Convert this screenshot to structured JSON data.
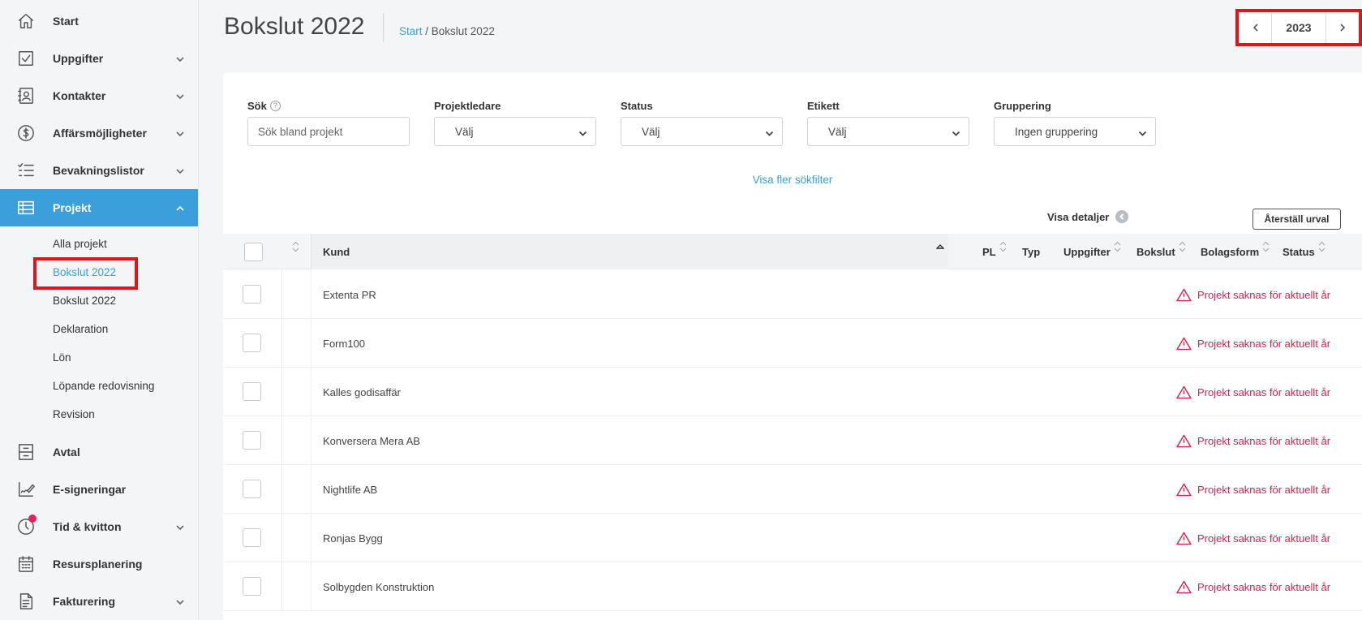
{
  "sidebar": {
    "items": [
      {
        "label": "Start",
        "icon": "home-icon"
      },
      {
        "label": "Uppgifter",
        "icon": "checkbox-icon"
      },
      {
        "label": "Kontakter",
        "icon": "contact-card-icon"
      },
      {
        "label": "Affärsmöjligheter",
        "icon": "dollar-icon"
      },
      {
        "label": "Bevakningslistor",
        "icon": "checklist-icon"
      },
      {
        "label": "Projekt",
        "icon": "table-icon"
      },
      {
        "label": "Avtal",
        "icon": "cabinet-icon"
      },
      {
        "label": "E-signeringar",
        "icon": "signature-icon"
      },
      {
        "label": "Tid & kvitton",
        "icon": "clock-icon"
      },
      {
        "label": "Resursplanering",
        "icon": "calendar-icon"
      },
      {
        "label": "Fakturering",
        "icon": "document-icon"
      }
    ],
    "project_sub": [
      "Alla projekt",
      "Bokslut 2022",
      "Bokslut 2022",
      "Deklaration",
      "Lön",
      "Löpande redovisning",
      "Revision"
    ]
  },
  "header": {
    "title": "Bokslut 2022",
    "breadcrumb_home": "Start",
    "breadcrumb_sep": " / ",
    "breadcrumb_current": "Bokslut 2022",
    "year": "2023"
  },
  "filters": {
    "search_label": "Sök",
    "search_help": "?",
    "search_placeholder": "Sök bland projekt",
    "projektledare_label": "Projektledare",
    "projektledare_value": "Välj",
    "status_label": "Status",
    "status_value": "Välj",
    "etikett_label": "Etikett",
    "etikett_value": "Välj",
    "gruppering_label": "Gruppering",
    "gruppering_value": "Ingen gruppering",
    "more_filters": "Visa fler sökfilter",
    "show_details": "Visa detaljer",
    "reset": "Återställ urval"
  },
  "table": {
    "headers": {
      "kund": "Kund",
      "pl": "PL",
      "typ": "Typ",
      "uppgifter": "Uppgifter",
      "bokslut": "Bokslut",
      "bolagsform": "Bolagsform",
      "status": "Status"
    },
    "warning_text": "Projekt saknas för aktuellt år",
    "rows": [
      {
        "kund": "Extenta PR"
      },
      {
        "kund": "Form100"
      },
      {
        "kund": "Kalles godisaffär"
      },
      {
        "kund": "Konversera Mera AB"
      },
      {
        "kund": "Nightlife AB"
      },
      {
        "kund": "Ronjas Bygg"
      },
      {
        "kund": "Solbygden Konstruktion"
      }
    ]
  },
  "colors": {
    "accent": "#3a9fdb",
    "highlight": "#e3131c",
    "warning": "#d6224e"
  }
}
